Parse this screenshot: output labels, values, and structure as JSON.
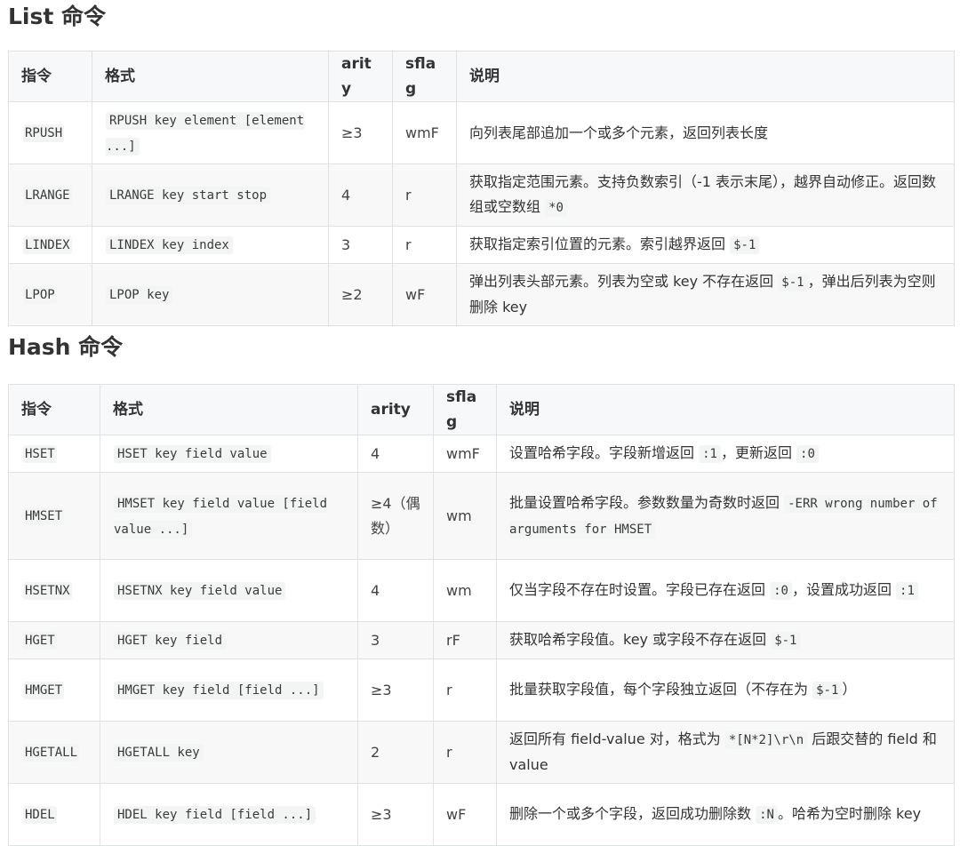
{
  "list_section": {
    "title": "List 命令",
    "headers": [
      "指令",
      "格式",
      "arity",
      "sflag",
      "说明"
    ],
    "rows": [
      {
        "cmd": "RPUSH",
        "format": "RPUSH key element [element ...]",
        "arity": "≥3",
        "sflag": "wmF",
        "desc": [
          {
            "t": "text",
            "v": "向列表尾部追加一个或多个元素，返回列表长度"
          }
        ]
      },
      {
        "cmd": "LRANGE",
        "format": "LRANGE key start stop",
        "arity": "4",
        "sflag": "r",
        "desc": [
          {
            "t": "text",
            "v": "获取指定范围元素。支持负数索引（-1 表示末尾），越界自动修正。返回数组或空数组 "
          },
          {
            "t": "code",
            "v": "*0"
          }
        ]
      },
      {
        "cmd": "LINDEX",
        "format": "LINDEX key index",
        "arity": "3",
        "sflag": "r",
        "desc": [
          {
            "t": "text",
            "v": "获取指定索引位置的元素。索引越界返回 "
          },
          {
            "t": "code",
            "v": "$-1"
          }
        ]
      },
      {
        "cmd": "LPOP",
        "format": "LPOP key",
        "arity": "≥2",
        "sflag": "wF",
        "desc": [
          {
            "t": "text",
            "v": "弹出列表头部元素。列表为空或 key 不存在返回 "
          },
          {
            "t": "code",
            "v": "$-1"
          },
          {
            "t": "text",
            "v": "，弹出后列表为空则删除 key"
          }
        ]
      }
    ]
  },
  "hash_section": {
    "title": "Hash 命令",
    "headers": [
      "指令",
      "格式",
      "arity",
      "sflag",
      "说明"
    ],
    "rows": [
      {
        "cmd": "HSET",
        "format": "HSET key field value",
        "arity": "4",
        "sflag": "wmF",
        "desc": [
          {
            "t": "text",
            "v": "设置哈希字段。字段新增返回 "
          },
          {
            "t": "code",
            "v": ":1"
          },
          {
            "t": "text",
            "v": "，更新返回 "
          },
          {
            "t": "code",
            "v": ":0"
          }
        ]
      },
      {
        "cmd": "HMSET",
        "format": "HMSET key field value [field value ...]",
        "arity": "≥4（偶数）",
        "sflag": "wm",
        "desc": [
          {
            "t": "text",
            "v": "批量设置哈希字段。参数数量为奇数时返回 "
          },
          {
            "t": "code",
            "v": "-ERR wrong number of arguments for HMSET"
          }
        ]
      },
      {
        "cmd": "HSETNX",
        "format": "HSETNX key field value",
        "arity": "4",
        "sflag": "wm",
        "desc": [
          {
            "t": "text",
            "v": "仅当字段不存在时设置。字段已存在返回 "
          },
          {
            "t": "code",
            "v": ":0"
          },
          {
            "t": "text",
            "v": "，设置成功返回 "
          },
          {
            "t": "code",
            "v": ":1"
          }
        ]
      },
      {
        "cmd": "HGET",
        "format": "HGET key field",
        "arity": "3",
        "sflag": "rF",
        "desc": [
          {
            "t": "text",
            "v": "获取哈希字段值。key 或字段不存在返回 "
          },
          {
            "t": "code",
            "v": "$-1"
          }
        ]
      },
      {
        "cmd": "HMGET",
        "format": "HMGET key field [field ...]",
        "arity": "≥3",
        "sflag": "r",
        "desc": [
          {
            "t": "text",
            "v": "批量获取字段值，每个字段独立返回（不存在为 "
          },
          {
            "t": "code",
            "v": "$-1"
          },
          {
            "t": "text",
            "v": "）"
          }
        ]
      },
      {
        "cmd": "HGETALL",
        "format": "HGETALL key",
        "arity": "2",
        "sflag": "r",
        "desc": [
          {
            "t": "text",
            "v": "返回所有 field-value 对，格式为 "
          },
          {
            "t": "code",
            "v": "*[N*2]\\r\\n"
          },
          {
            "t": "text",
            "v": " 后跟交替的 field 和 value"
          }
        ]
      },
      {
        "cmd": "HDEL",
        "format": "HDEL key field [field ...]",
        "arity": "≥3",
        "sflag": "wF",
        "desc": [
          {
            "t": "text",
            "v": "删除一个或多个字段，返回成功删除数 "
          },
          {
            "t": "code",
            "v": ":N"
          },
          {
            "t": "text",
            "v": "。哈希为空时删除 key"
          }
        ]
      }
    ]
  }
}
